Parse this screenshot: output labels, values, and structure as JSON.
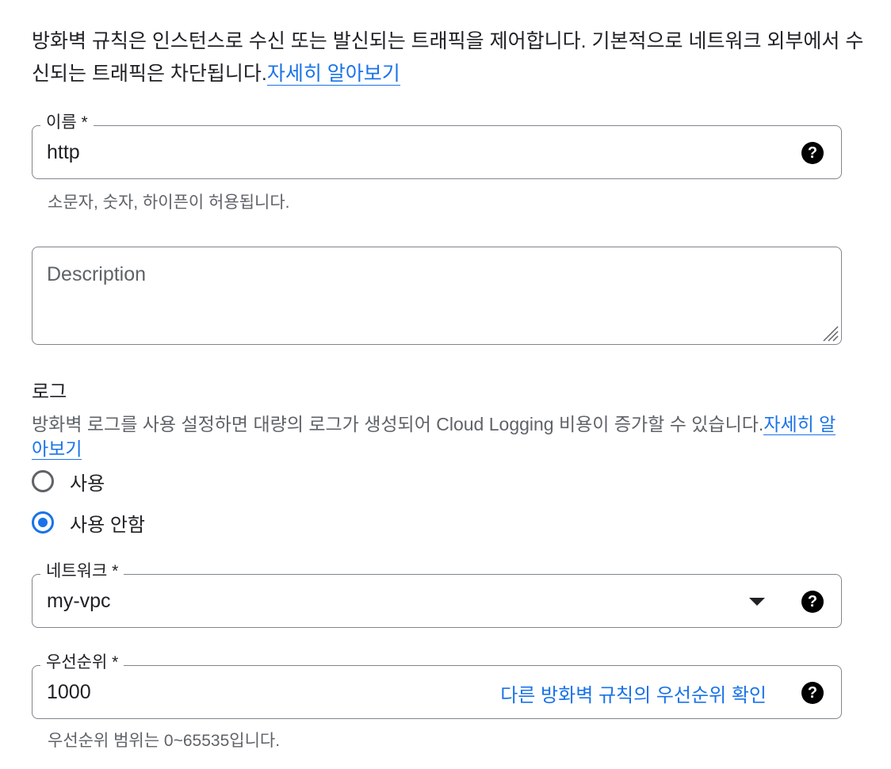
{
  "intro": {
    "text": "방화벽 규칙은 인스턴스로 수신 또는 발신되는 트래픽을 제어합니다. 기본적으로 네트워크 외부에서 수신되는 트래픽은 차단됩니다.",
    "link": "자세히 알아보기"
  },
  "name_field": {
    "label": "이름 *",
    "value": "http",
    "help_icon": "?",
    "hint": "소문자, 숫자, 하이픈이 허용됩니다."
  },
  "description_field": {
    "placeholder": "Description"
  },
  "logs": {
    "title": "로그",
    "description": "방화벽 로그를 사용 설정하면 대량의 로그가 생성되어 Cloud Logging 비용이 증가할 수 있습니다.",
    "link": "자세히 알아보기",
    "options": [
      {
        "label": "사용",
        "selected": false
      },
      {
        "label": "사용 안함",
        "selected": true
      }
    ]
  },
  "network_field": {
    "label": "네트워크 *",
    "value": "my-vpc",
    "help_icon": "?"
  },
  "priority_field": {
    "label": "우선순위 *",
    "value": "1000",
    "link": "다른 방화벽 규칙의 우선순위 확인",
    "help_icon": "?",
    "hint": "우선순위 범위는 0~65535입니다."
  },
  "colors": {
    "accent": "#1a73e8",
    "border": "#80868b",
    "text": "#202124",
    "muted_text": "#5f6368"
  }
}
